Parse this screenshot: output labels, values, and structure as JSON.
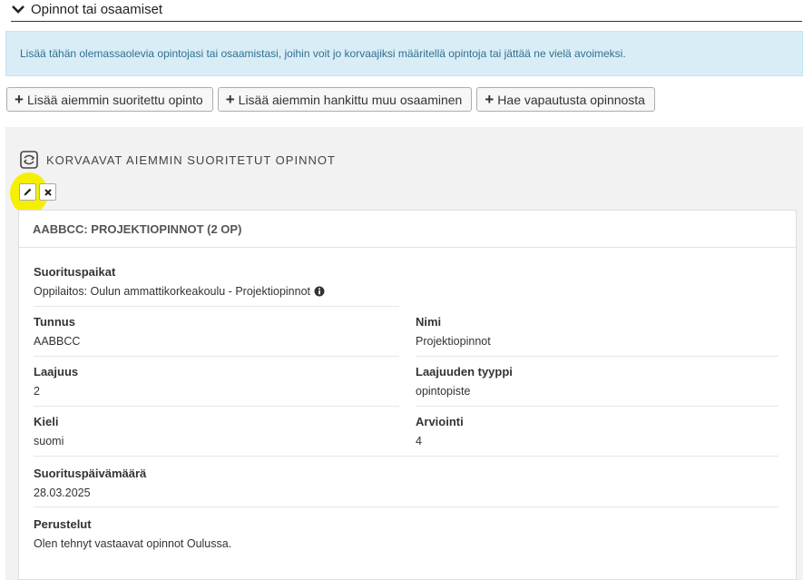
{
  "section": {
    "title": "Opinnot tai osaamiset"
  },
  "info": {
    "text": "Lisää tähän olemassaolevia opintojasi tai osaamistasi, joihin voit jo korvaajiksi määritellä opintoja tai jättää ne vielä avoimeksi."
  },
  "buttons": {
    "add_study": "Lisää aiemmin suoritettu opinto",
    "add_competence": "Lisää aiemmin hankittu muu osaaminen",
    "request_exemption": "Hae vapautusta opinnosta"
  },
  "panel": {
    "title": "KORVAAVAT AIEMMIN SUORITETUT OPINNOT",
    "card_title": "AABBCC: PROJEKTIOPINNOT (2 OP)",
    "fields": {
      "suorituspaikat_label": "Suorituspaikat",
      "suorituspaikat_value": "Oppilaitos: Oulun ammattikorkeakoulu - Projektiopinnot",
      "tunnus_label": "Tunnus",
      "tunnus_value": "AABBCC",
      "nimi_label": "Nimi",
      "nimi_value": "Projektiopinnot",
      "laajuus_label": "Laajuus",
      "laajuus_value": "2",
      "laajuuden_tyyppi_label": "Laajuuden tyyppi",
      "laajuuden_tyyppi_value": "opintopiste",
      "kieli_label": "Kieli",
      "kieli_value": "suomi",
      "arviointi_label": "Arviointi",
      "arviointi_value": "4",
      "suorituspaivamaara_label": "Suorituspäivämäärä",
      "suorituspaivamaara_value": "28.03.2025",
      "perustelut_label": "Perustelut",
      "perustelut_value": "Olen tehnyt vastaavat opinnot Oulussa."
    }
  },
  "colors": {
    "info_bg": "#d9edf7",
    "info_text": "#31708f",
    "panel_bg": "#f2f2f2",
    "highlight": "#f5ef00"
  },
  "icons": {
    "section_toggle": "chevron-down-icon",
    "add": "plus-icon",
    "panel": "study-swap-icon",
    "edit": "pencil-icon",
    "delete": "close-icon",
    "info": "info-circle-icon"
  }
}
